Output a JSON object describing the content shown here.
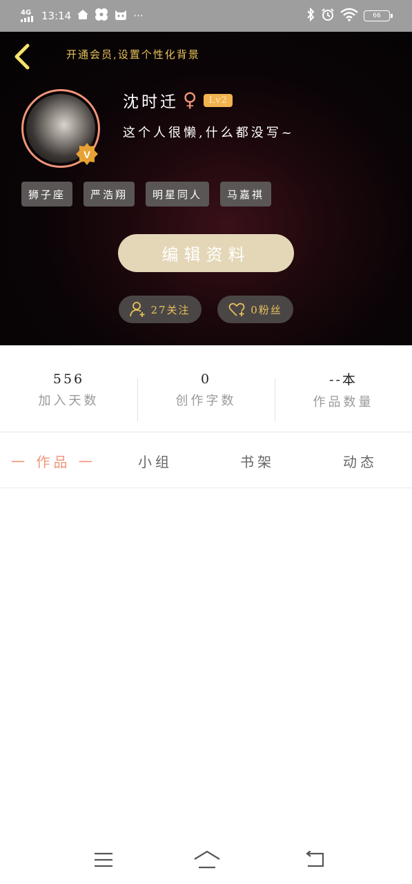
{
  "status_bar": {
    "network": "4G",
    "time": "13:14",
    "extra": "···",
    "battery": "66"
  },
  "header": {
    "vip_promo": "开通会员,设置个性化背景",
    "username": "沈时迁",
    "gender_symbol": "♀",
    "level": "Lv2",
    "bio": "这个人很懒,什么都没写~",
    "badge_letter": "V",
    "tags": [
      "狮子座",
      "严浩翔",
      "明星同人",
      "马嘉祺"
    ],
    "edit_label": "编辑资料",
    "following_label": "27关注",
    "fans_label": "0粉丝"
  },
  "stats": [
    {
      "value": "556",
      "label": "加入天数"
    },
    {
      "value": "0",
      "label": "创作字数"
    },
    {
      "value": "--本",
      "label": "作品数量"
    }
  ],
  "tabs": {
    "works": "一 作品 一",
    "group": "小组",
    "shelf": "书架",
    "dynamic": "动态"
  },
  "colors": {
    "accent": "#f0957a",
    "gold": "#e8c25a",
    "edit_button": "#e4d7b8",
    "level_badge": "#f2b350"
  }
}
